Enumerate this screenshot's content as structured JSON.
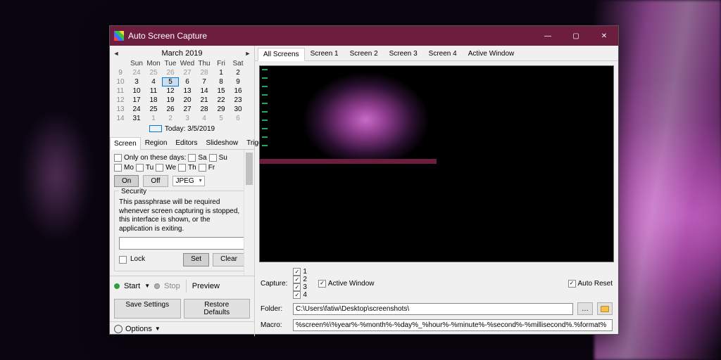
{
  "title": "Auto Screen Capture",
  "calendar": {
    "month_label": "March 2019",
    "dow": [
      "Sun",
      "Mon",
      "Tue",
      "Wed",
      "Thu",
      "Fri",
      "Sat"
    ],
    "weeks": [
      {
        "wk": "9",
        "days": [
          {
            "d": "24",
            "g": true
          },
          {
            "d": "25",
            "g": true
          },
          {
            "d": "26",
            "g": true
          },
          {
            "d": "27",
            "g": true
          },
          {
            "d": "28",
            "g": true
          },
          {
            "d": "1"
          },
          {
            "d": "2"
          }
        ]
      },
      {
        "wk": "10",
        "days": [
          {
            "d": "3"
          },
          {
            "d": "4"
          },
          {
            "d": "5",
            "today": true
          },
          {
            "d": "6"
          },
          {
            "d": "7"
          },
          {
            "d": "8"
          },
          {
            "d": "9"
          }
        ]
      },
      {
        "wk": "11",
        "days": [
          {
            "d": "10"
          },
          {
            "d": "11"
          },
          {
            "d": "12"
          },
          {
            "d": "13"
          },
          {
            "d": "14"
          },
          {
            "d": "15"
          },
          {
            "d": "16"
          }
        ]
      },
      {
        "wk": "12",
        "days": [
          {
            "d": "17"
          },
          {
            "d": "18"
          },
          {
            "d": "19"
          },
          {
            "d": "20"
          },
          {
            "d": "21"
          },
          {
            "d": "22"
          },
          {
            "d": "23"
          }
        ]
      },
      {
        "wk": "13",
        "days": [
          {
            "d": "24"
          },
          {
            "d": "25"
          },
          {
            "d": "26"
          },
          {
            "d": "27"
          },
          {
            "d": "28"
          },
          {
            "d": "29"
          },
          {
            "d": "30"
          }
        ]
      },
      {
        "wk": "14",
        "days": [
          {
            "d": "31"
          },
          {
            "d": "1",
            "g": true
          },
          {
            "d": "2",
            "g": true
          },
          {
            "d": "3",
            "g": true
          },
          {
            "d": "4",
            "g": true
          },
          {
            "d": "5",
            "g": true
          },
          {
            "d": "6",
            "g": true
          }
        ]
      }
    ],
    "today_label": "Today: 3/5/2019"
  },
  "left_tabs": [
    "Screen",
    "Region",
    "Editors",
    "Slideshow",
    "Triggers"
  ],
  "left_tab_active": 0,
  "screen_tab": {
    "only_days_label": "Only on these days:",
    "day_abbr": [
      "Sa",
      "Su",
      "Mo",
      "Tu",
      "We",
      "Th",
      "Fr"
    ],
    "on_label": "On",
    "off_label": "Off",
    "format_value": "JPEG",
    "security": {
      "legend": "Security",
      "desc": "This passphrase will be required whenever screen capturing is stopped, this interface is shown, or the application is exiting.",
      "lock_label": "Lock",
      "set_label": "Set",
      "clear_label": "Clear"
    }
  },
  "commands": {
    "start": "Start",
    "stop": "Stop",
    "preview": "Preview"
  },
  "bottom": {
    "save": "Save Settings",
    "restore": "Restore Defaults"
  },
  "options_label": "Options",
  "screen_tabs": [
    "All Screens",
    "Screen 1",
    "Screen 2",
    "Screen 3",
    "Screen 4",
    "Active Window"
  ],
  "screen_tab_active": 0,
  "capture": {
    "label": "Capture:",
    "items": [
      "1",
      "2",
      "3",
      "4"
    ],
    "active_window": "Active Window",
    "auto_reset": "Auto Reset"
  },
  "folder": {
    "label": "Folder:",
    "value": "C:\\Users\\fatiw\\Desktop\\screenshots\\"
  },
  "macro": {
    "label": "Macro:",
    "value": "%screen%\\%year%-%month%-%day%_%hour%-%minute%-%second%-%millisecond%.%format%"
  }
}
